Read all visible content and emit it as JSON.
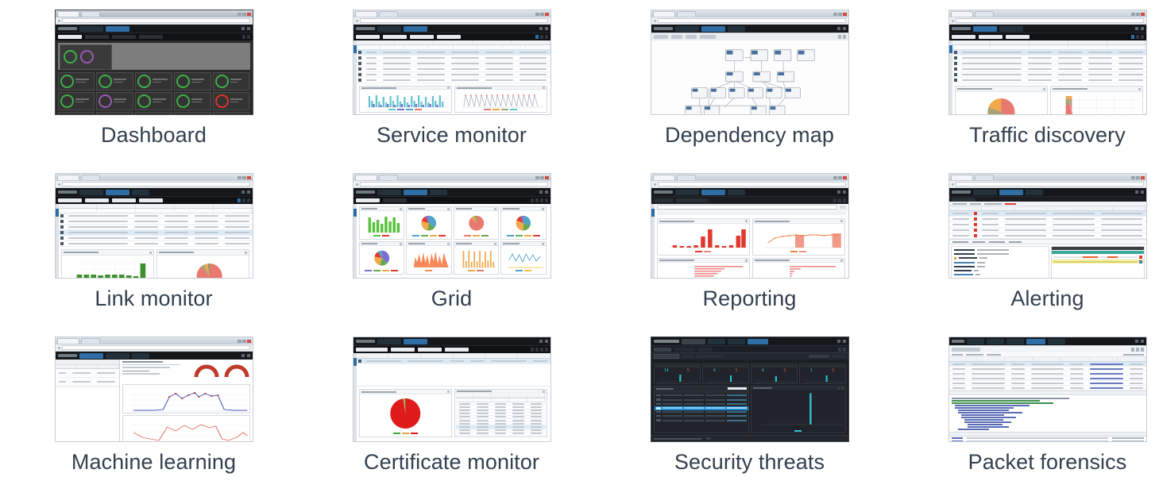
{
  "page": {
    "background": "#ffffff",
    "caption_color": "#33404f",
    "columns": 4,
    "rows": 3
  },
  "gallery": {
    "items": [
      {
        "id": "dashboard",
        "label": "Dashboard",
        "thumb_kind": "dark-dashboard",
        "accent": "#3fae49",
        "row": 1,
        "col": 1
      },
      {
        "id": "service-monitor",
        "label": "Service monitor",
        "thumb_kind": "table-and-charts",
        "accent": "#4da3c9",
        "row": 1,
        "col": 2
      },
      {
        "id": "dependency-map",
        "label": "Dependency map",
        "thumb_kind": "node-graph",
        "accent": "#4a6f9a",
        "row": 1,
        "col": 3
      },
      {
        "id": "traffic-discovery",
        "label": "Traffic discovery",
        "thumb_kind": "pie-and-area",
        "accent": "#e8796f",
        "row": 1,
        "col": 4
      },
      {
        "id": "link-monitor",
        "label": "Link monitor",
        "thumb_kind": "bars-and-pie",
        "accent": "#3f8f2f",
        "row": 2,
        "col": 1
      },
      {
        "id": "grid",
        "label": "Grid",
        "thumb_kind": "chart-grid",
        "accent": "#57c23a",
        "row": 2,
        "col": 2
      },
      {
        "id": "reporting",
        "label": "Reporting",
        "thumb_kind": "report-charts",
        "accent": "#e03a2f",
        "row": 2,
        "col": 3
      },
      {
        "id": "alerting",
        "label": "Alerting",
        "thumb_kind": "alert-list",
        "accent": "#e8a33d",
        "row": 2,
        "col": 4
      },
      {
        "id": "machine-learning",
        "label": "Machine learning",
        "thumb_kind": "ml-gauges",
        "accent": "#c0392b",
        "row": 3,
        "col": 1
      },
      {
        "id": "certificate-monitor",
        "label": "Certificate monitor",
        "thumb_kind": "cert-pie",
        "accent": "#e01b1b",
        "row": 3,
        "col": 2
      },
      {
        "id": "security-threats",
        "label": "Security threats",
        "thumb_kind": "dark-threats",
        "accent": "#2ec5d3",
        "row": 3,
        "col": 3
      },
      {
        "id": "packet-forensics",
        "label": "Packet forensics",
        "thumb_kind": "packet-list",
        "accent": "#5b6cb5",
        "row": 3,
        "col": 4
      }
    ]
  },
  "thumbnail_details": {
    "dashboard": {
      "style": "dark theme NOC dashboard",
      "tiles_per_row": 5,
      "tile_rows": 3,
      "status_ring_colors": [
        "#3fae49",
        "#e0322d",
        "#9b59b6"
      ]
    },
    "service_monitor": {
      "layout": "data grid on top, four charts below",
      "chart_types": [
        "bar",
        "line",
        "line",
        "bar"
      ]
    },
    "dependency_map": {
      "layout": "hierarchical node graph, 4 tiers"
    },
    "traffic_discovery": {
      "layout": "data grid on top, pie chart and stacked area chart below",
      "pie_colors": [
        "#e8796f",
        "#a8a274",
        "#f0a84b"
      ]
    },
    "link_monitor": {
      "layout": "data grid on top, green bar chart and pie chart below"
    },
    "grid": {
      "layout": "8 chart panels in 4x2 grid",
      "chart_types": [
        "bar",
        "pie",
        "pie",
        "pie",
        "pie",
        "area",
        "bar",
        "line"
      ]
    },
    "reporting": {
      "layout": "4 report panels, red/orange series",
      "chart_types": [
        "bar",
        "line",
        "horizontal-bar",
        "horizontal-bar"
      ]
    },
    "alerting": {
      "layout": "alert table on top, detail pane and timeline bars below"
    },
    "machine_learning": {
      "layout": "left list pane, two gauges and two line charts"
    },
    "certificate_monitor": {
      "layout": "certificate grid on top, red pie chart and detail table below"
    },
    "security_threats": {
      "style": "dark theme",
      "kpi_cards": [
        {
          "violations": "14",
          "hosts": "5"
        },
        {
          "violations": "4",
          "hosts": "3"
        },
        {
          "violations": "4",
          "hosts": "3"
        },
        {
          "violations": "1",
          "hosts": "2"
        }
      ]
    },
    "packet_forensics": {
      "layout": "packet list, protocol tree, hex dump"
    }
  }
}
